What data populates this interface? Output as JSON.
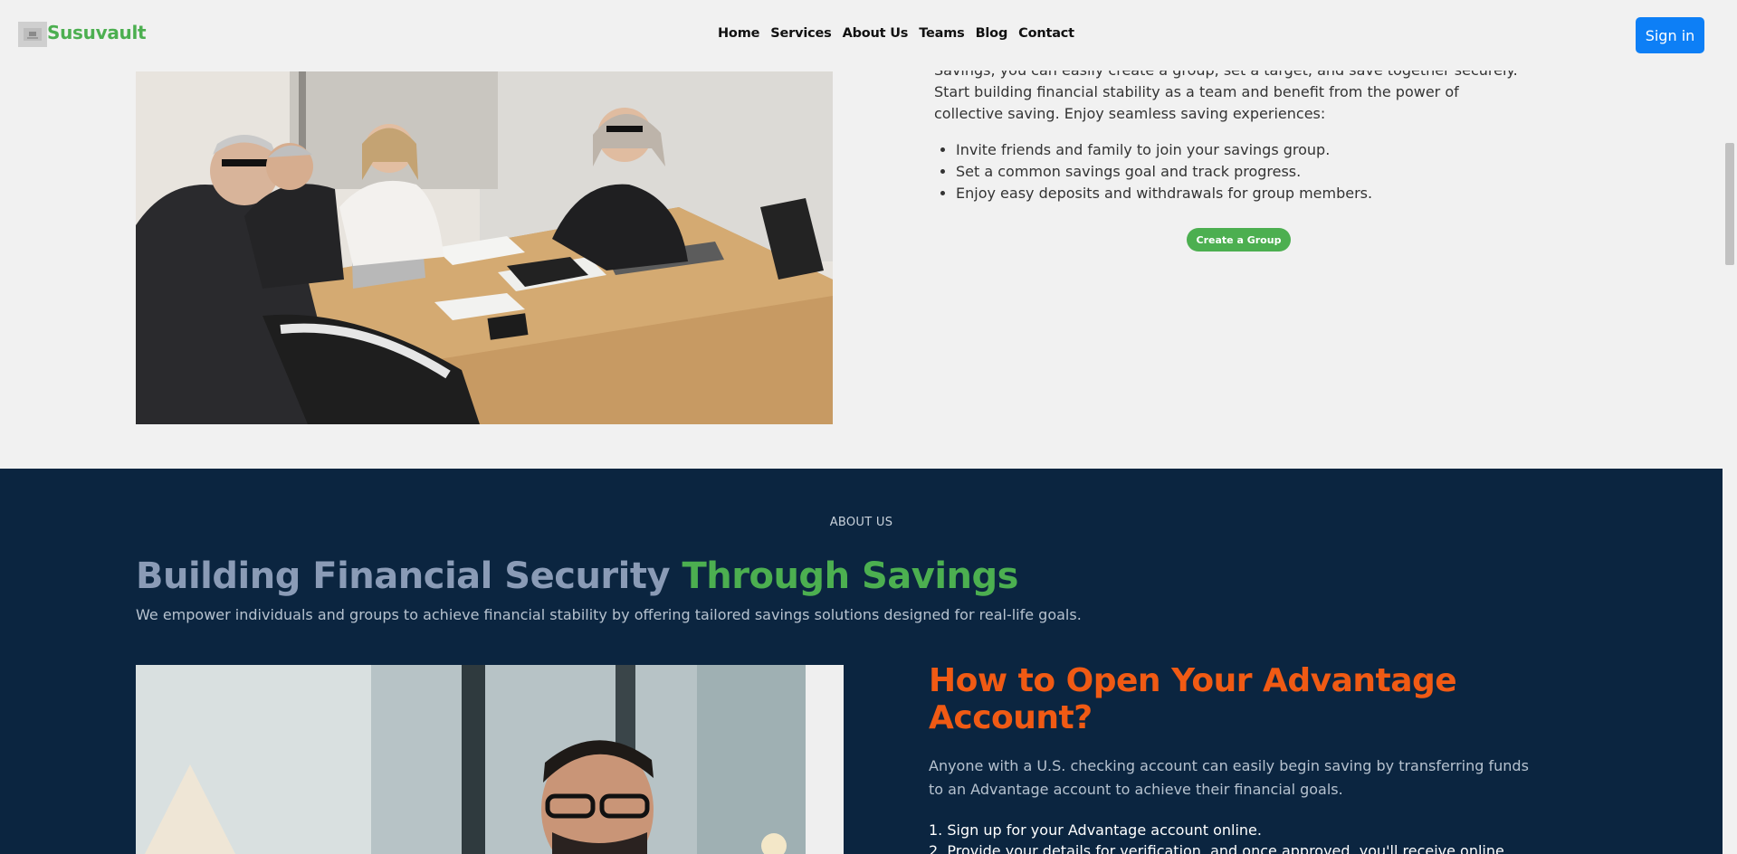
{
  "nav": {
    "brand": "Susuvault",
    "links": [
      "Home",
      "Services",
      "About Us",
      "Teams",
      "Blog",
      "Contact"
    ],
    "signin_label": "Sign in"
  },
  "group_savings": {
    "partial_line": "Savings, you can easily create a group, set a target, and save together securely.",
    "paragraph": "Start building financial stability as a team and benefit from the power of collective saving. Enjoy seamless saving experiences:",
    "bullets": [
      "Invite friends and family to join your savings group.",
      "Set a common savings goal and track progress.",
      "Enjoy easy deposits and withdrawals for group members."
    ],
    "cta_label": "Create a Group"
  },
  "about": {
    "label": "ABOUT US",
    "title_part1": "Building Financial Security ",
    "title_part2": "Through Savings",
    "subtitle": "We empower individuals and groups to achieve financial stability by offering tailored savings solutions designed for real-life goals."
  },
  "advantage": {
    "title": "How to Open Your Advantage Account?",
    "description": "Anyone with a U.S. checking account can easily begin saving by transferring funds to an Advantage account to achieve their financial goals.",
    "steps": [
      "1. Sign up for your Advantage account online.",
      "2. Provide your details for verification, and once approved, you'll receive online"
    ]
  },
  "colors": {
    "brand_green": "#4caf50",
    "accent_orange": "#f05a14",
    "dark_navy": "#0b2540",
    "primary_blue": "#0d7ff6"
  }
}
